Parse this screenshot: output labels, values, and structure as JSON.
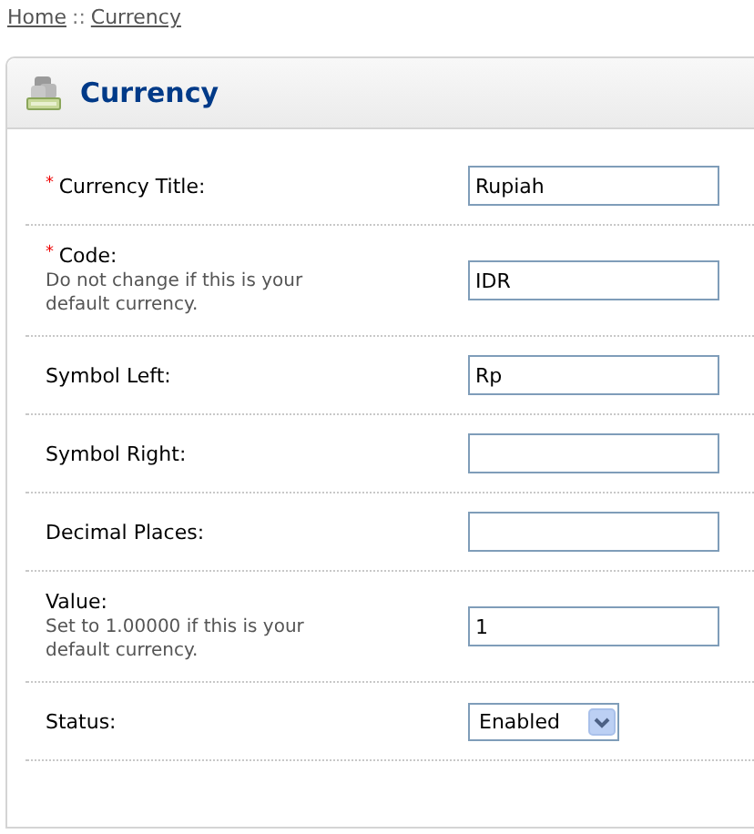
{
  "breadcrumb": [
    {
      "label": "Home"
    },
    {
      "label": "Currency"
    }
  ],
  "breadcrumb_separator": "::",
  "panel": {
    "title": "Currency"
  },
  "required_mark": "*",
  "fields": [
    {
      "kind": "text",
      "label": "Currency Title:",
      "required": true,
      "value": "Rupiah"
    },
    {
      "kind": "text",
      "label": "Code:",
      "required": true,
      "help": "Do not change if this is your default currency.",
      "value": "IDR"
    },
    {
      "kind": "text",
      "label": "Symbol Left:",
      "required": false,
      "value": "Rp"
    },
    {
      "kind": "text",
      "label": "Symbol Right:",
      "required": false
    },
    {
      "kind": "text",
      "label": "Decimal Places:",
      "required": false
    },
    {
      "kind": "text",
      "label": "Value:",
      "required": false,
      "help": "Set to 1.00000 if this is your default currency.",
      "value": "1"
    },
    {
      "kind": "select",
      "label": "Status:",
      "required": false,
      "value": "Enabled"
    }
  ]
}
